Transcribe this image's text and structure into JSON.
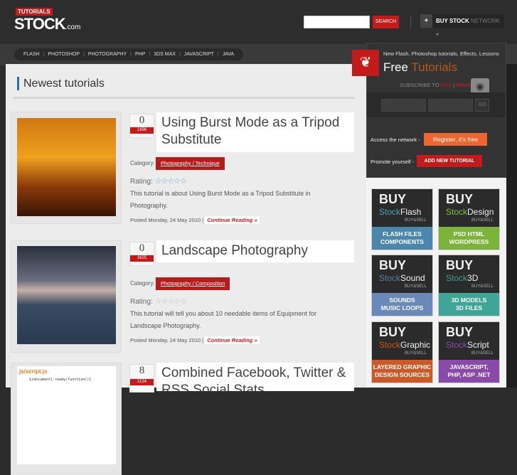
{
  "header": {
    "logo_tag": "TUTORIALS",
    "logo_main": "STOCK",
    "logo_suffix": ".com",
    "search_placeholder": "",
    "search_button": "SEARCH",
    "network_bold": "BUY STOCK",
    "network_rest": " NETWORK ▾"
  },
  "nav": [
    "FLASH",
    "PHOTOSHOP",
    "PHOTOGRAPHY",
    "PHP",
    "3DS MAX",
    "JAVASCRIPT",
    "JAVA"
  ],
  "main": {
    "heading": "Newest tutorials",
    "posts": [
      {
        "count": "0",
        "views": "1496",
        "title": "Using Burst Mode as a Tripod Substitute",
        "category_label": "Category:",
        "category": "Photography / Technique",
        "rating_label": "Rating:",
        "stars": "☆☆☆☆☆",
        "desc": "This tutorial is about Using Burst Mode as a Tripod Substitute in Photography.",
        "posted": "Posted Monday, 24 May 2010 |",
        "continue": "Continue Reading »"
      },
      {
        "count": "0",
        "views": "1625",
        "title": "Landscape Photography",
        "category_label": "Category:",
        "category": "Photography / Composition",
        "rating_label": "Rating:",
        "stars": "☆☆☆☆☆",
        "desc": "This tutorial will tell you about 10 needable items of Equipment for Landscape Photography.",
        "posted": "Posted Monday, 24 May 2010 |",
        "continue": "Continue Reading »"
      },
      {
        "count": "8",
        "views": "1134",
        "title": "Combined Facebook, Twitter & RSS Social Stats",
        "thumb_file": "js/script.js",
        "thumb_code": "$(document).ready(function(){"
      }
    ]
  },
  "sidebar": {
    "tagline": "New Flash, Photoshop tutorials, Effects, Lessons",
    "free": "Free",
    "tutorials": "Tutorials",
    "subscribe": "SUBSCRIBE TO",
    "rss": "RSS",
    "sep": "|",
    "email": "EMAIL",
    "go": "GO",
    "access": "Access the network -",
    "register": "Register, it's free",
    "promote": "Promote yourself -",
    "add": "ADD NEW TUTORIAL",
    "banners": [
      {
        "buy": "BUY",
        "stock": "Stock",
        "name": "Flash",
        "bs": "BUY&SELL",
        "l1": "FLASH FILES",
        "l2": "COMPONENTS",
        "color": "#4a86ad",
        "accent": "#4aa0c0"
      },
      {
        "buy": "BUY",
        "stock": "Stock",
        "name": "Design",
        "bs": "BUY&SELL",
        "l1": "PSD  HTML",
        "l2": "WORDPRESS",
        "color": "#7ab43a",
        "accent": "#7ac23a"
      },
      {
        "buy": "BUY",
        "stock": "Stock",
        "name": "Sound",
        "bs": "BUY&SELL",
        "l1": "SOUNDS",
        "l2": "MUSIC LOOPS",
        "color": "#6a88b8",
        "accent": "#5a7aaa"
      },
      {
        "buy": "BUY",
        "stock": "Stock",
        "name": "3D",
        "bs": "BUY&SELL",
        "l1": "3D MODELS",
        "l2": "3D FILES",
        "color": "#3fa596",
        "accent": "#3aa090"
      },
      {
        "buy": "BUY",
        "stock": "Stock",
        "name": "Graphic",
        "bs": "BUY&SELL",
        "l1": "LAYERED GRAPHIC",
        "l2": "DESIGN SOURCES",
        "color": "#cc5a28",
        "accent": "#d0501e"
      },
      {
        "buy": "BUY",
        "stock": "Stock",
        "name": "Script",
        "bs": "BUY&SELL",
        "l1": "JAVASCRIPT,",
        "l2": "PHP, ASP .NET",
        "color": "#8a4aa8",
        "accent": "#8a48a8"
      }
    ]
  }
}
